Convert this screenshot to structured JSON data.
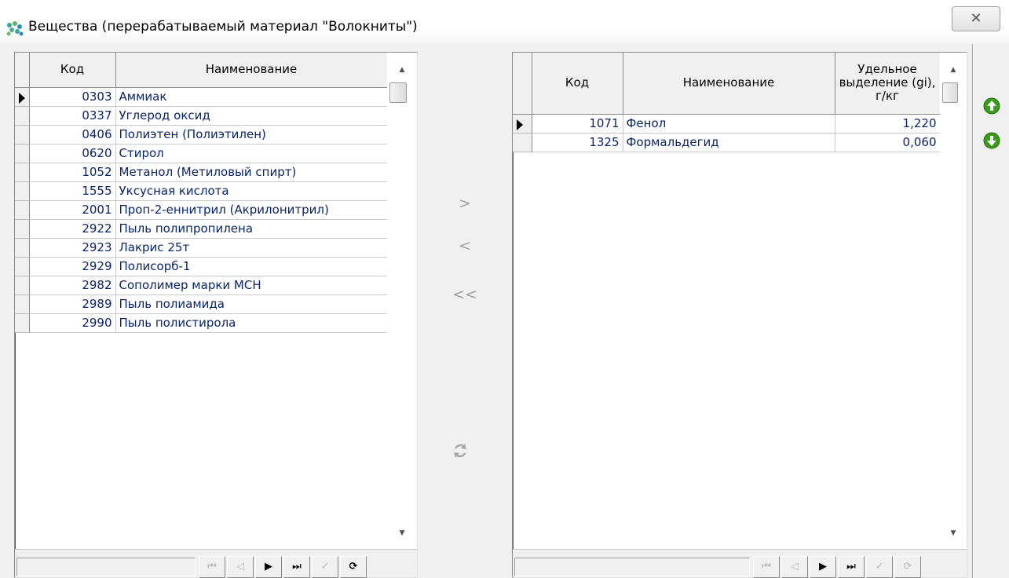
{
  "window": {
    "title": "Вещества (перерабатываемый материал \"Волокниты\")",
    "close_glyph": "✕",
    "icon": "substance-molecule-icon"
  },
  "left_grid": {
    "columns": [
      "Код",
      "Наименование"
    ],
    "rows": [
      {
        "code": "0303",
        "name": "Аммиак"
      },
      {
        "code": "0337",
        "name": "Углерод оксид"
      },
      {
        "code": "0406",
        "name": "Полиэтен (Полиэтилен)"
      },
      {
        "code": "0620",
        "name": "Стирол"
      },
      {
        "code": "1052",
        "name": "Метанол (Метиловый спирт)"
      },
      {
        "code": "1555",
        "name": "Уксусная кислота"
      },
      {
        "code": "2001",
        "name": "Проп-2-еннитрил (Акрилонитрил)"
      },
      {
        "code": "2922",
        "name": "Пыль полипропилена"
      },
      {
        "code": "2923",
        "name": "Лакрис 25т"
      },
      {
        "code": "2929",
        "name": "Полисорб-1"
      },
      {
        "code": "2982",
        "name": "Сополимер марки МСН"
      },
      {
        "code": "2989",
        "name": "Пыль полиамида"
      },
      {
        "code": "2990",
        "name": "Пыль полистирола"
      }
    ],
    "current_row": 0
  },
  "right_grid": {
    "columns": [
      "Код",
      "Наименование",
      "Удельное выделение (gi), г/кг"
    ],
    "rows": [
      {
        "code": "1071",
        "name": "Фенол",
        "value": "1,220"
      },
      {
        "code": "1325",
        "name": "Формальдегид",
        "value": "0,060"
      }
    ],
    "current_row": 0
  },
  "transfer": {
    "add_label": ">",
    "remove_label": "<",
    "remove_all_label": "<<",
    "refresh_icon": "refresh-icon"
  },
  "navigator": {
    "first": "⏮",
    "prior": "◁",
    "next": "▶",
    "last": "⏭",
    "post": "✓",
    "refresh": "⟳"
  },
  "order": {
    "up_icon": "arrow-up-circle-icon",
    "down_icon": "arrow-down-circle-icon"
  },
  "colors": {
    "cell_text": "#0a246a",
    "grid_line": "#c8c8c8",
    "face": "#f0f0f0",
    "order_button": "#3a9a1a"
  }
}
